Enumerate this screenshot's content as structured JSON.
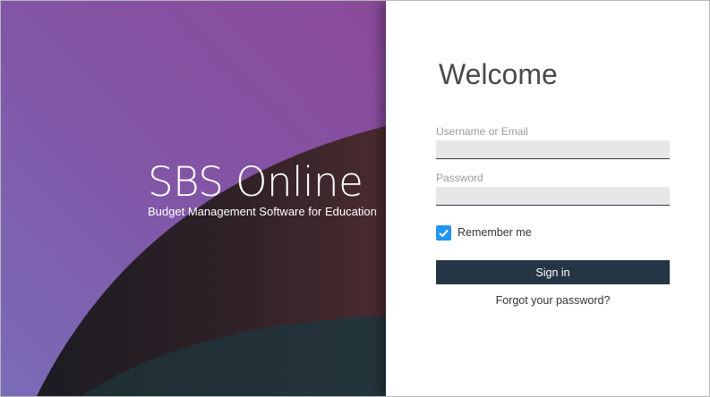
{
  "brand": {
    "title": "SBS Online",
    "subtitle": "Budget Management Software for Education"
  },
  "login": {
    "heading": "Welcome",
    "username_label": "Username or Email",
    "username_value": "",
    "password_label": "Password",
    "password_value": "",
    "remember_label": "Remember me",
    "remember_checked": true,
    "signin_label": "Sign in",
    "forgot_label": "Forgot your password?"
  },
  "colors": {
    "hero_purple": "#8a4f9e",
    "hero_dark": "#2b2126",
    "hero_teal": "#23323a",
    "button": "#253545",
    "checkbox": "#2196f3",
    "input_bg": "#e7e7e7"
  }
}
